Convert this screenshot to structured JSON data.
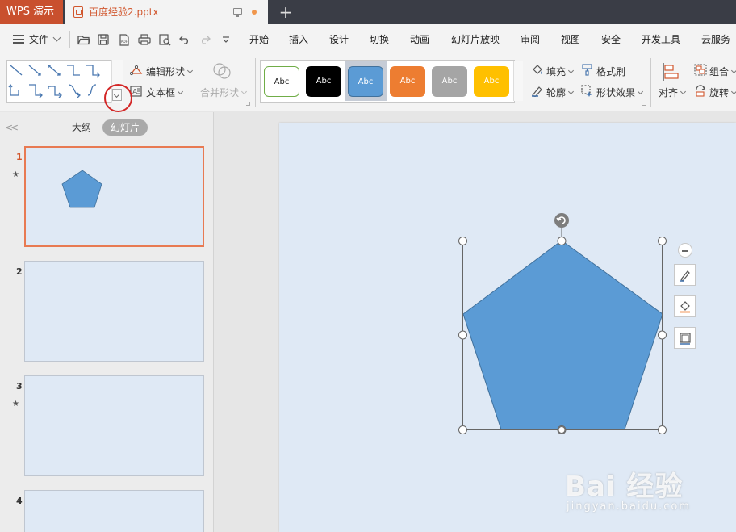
{
  "titlebar": {
    "app_tab": "WPS 演示",
    "doc_title": "百度经验2.pptx",
    "new_tab": "+"
  },
  "menubar": {
    "file_label": "文件",
    "tabs": [
      "开始",
      "插入",
      "设计",
      "切换",
      "动画",
      "幻灯片放映",
      "审阅",
      "视图",
      "安全",
      "开发工具",
      "云服务"
    ]
  },
  "ribbon": {
    "edit_shape": "编辑形状",
    "text_box": "文本框",
    "merge_shapes": "合并形状",
    "style_swatch_label": "Abc",
    "fill": "填充",
    "format_painter": "格式刷",
    "outline": "轮廓",
    "shape_effects": "形状效果",
    "align": "对齐",
    "group": "组合",
    "rotate": "旋转",
    "style_colors": {
      "white": "#ffffff",
      "black": "#000000",
      "blue": "#5b9bd5",
      "orange": "#ed7d31",
      "gray": "#a5a5a5",
      "gold": "#ffc000"
    },
    "style_borders": {
      "white": "#70ad47"
    }
  },
  "left_panel": {
    "outline_tab": "大纲",
    "slides_tab": "幻灯片",
    "slides": [
      {
        "number": "1",
        "has_animation": true
      },
      {
        "number": "2",
        "has_animation": false
      },
      {
        "number": "3",
        "has_animation": true
      },
      {
        "number": "4",
        "has_animation": false
      }
    ]
  },
  "canvas": {
    "shape": "pentagon",
    "shape_fill": "#5b9bd5",
    "shape_stroke": "#41719c"
  },
  "watermark": {
    "main": "Bai 经验",
    "sub": "jingyan.baidu.com"
  },
  "colors": {
    "accent": "#d1572e",
    "titlebar_bg": "#3a3d46",
    "app_tab_bg": "#c9502e",
    "slide_bg": "#dfe9f5"
  }
}
